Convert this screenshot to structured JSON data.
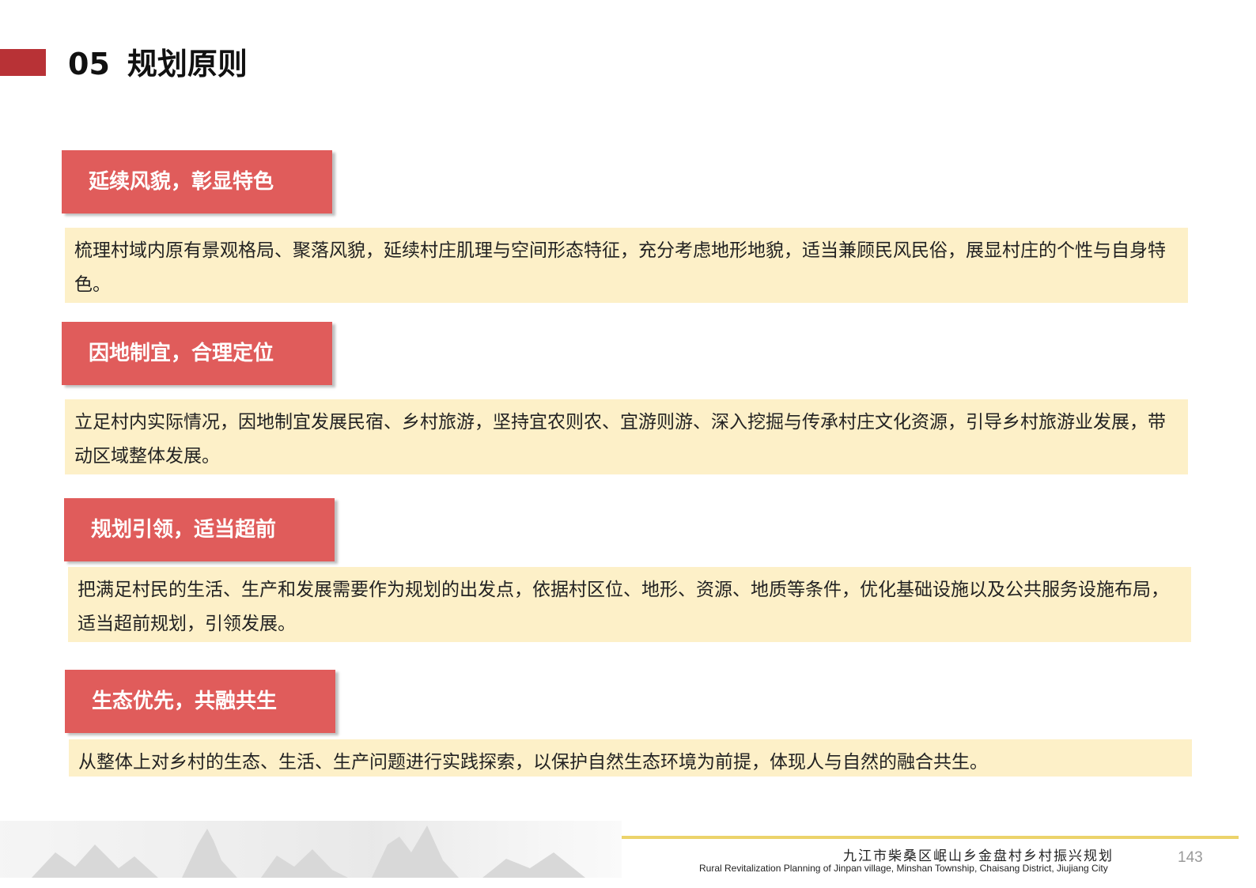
{
  "header": {
    "number": "05",
    "title": "规划原则"
  },
  "principles": [
    {
      "heading": "延续风貌，彰显特色",
      "description": "梳理村域内原有景观格局、聚落风貌，延续村庄肌理与空间形态特征，充分考虑地形地貌，适当兼顾民风民俗，展显村庄的个性与自身特色。"
    },
    {
      "heading": "因地制宜，合理定位",
      "description": "立足村内实际情况，因地制宜发展民宿、乡村旅游，坚持宜农则农、宜游则游、深入挖掘与传承村庄文化资源，引导乡村旅游业发展，带动区域整体发展。"
    },
    {
      "heading": "规划引领，适当超前",
      "description": "把满足村民的生活、生产和发展需要作为规划的出发点，依据村区位、地形、资源、地质等条件，优化基础设施以及公共服务设施布局，适当超前规划，引领发展。"
    },
    {
      "heading": "生态优先，共融共生",
      "description": "从整体上对乡村的生态、生活、生产问题进行实践探索，以保护自然生态环境为前提，体现人与自然的融合共生。"
    }
  ],
  "footer": {
    "project_cn": "九江市柴桑区岷山乡金盘村乡村振兴规划",
    "project_en": "Rural Revitalization Planning of Jinpan village, Minshan Township, Chaisang District, Jiujiang City",
    "page_number": "143"
  },
  "colors": {
    "accent_bar": "#b83236",
    "heading_tab": "#e05c5b",
    "description_bg": "#fdf0c8",
    "footer_line": "#ecd36b"
  }
}
